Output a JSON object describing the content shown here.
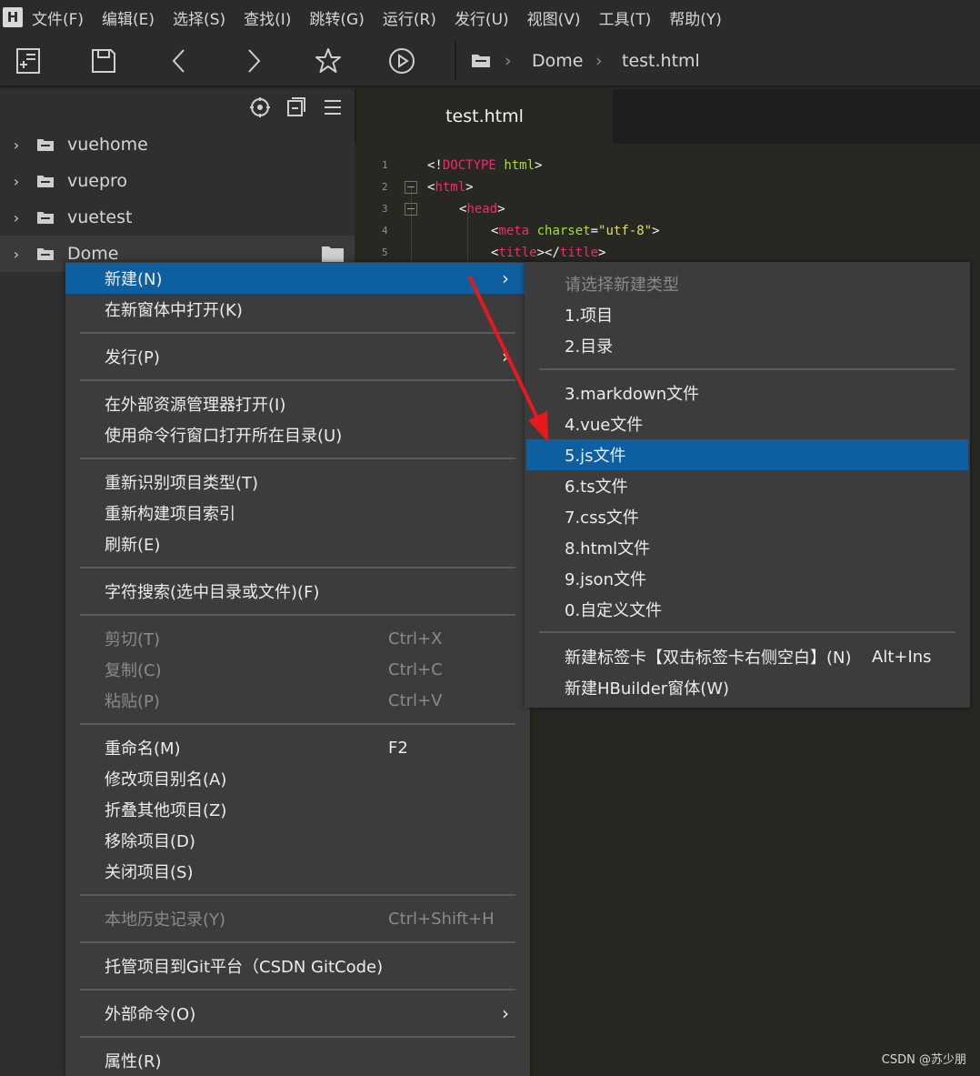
{
  "menubar": {
    "logo": "H",
    "items": [
      "文件(F)",
      "编辑(E)",
      "选择(S)",
      "查找(I)",
      "跳转(G)",
      "运行(R)",
      "发行(U)",
      "视图(V)",
      "工具(T)",
      "帮助(Y)"
    ]
  },
  "toolbar": {
    "breadcrumb": [
      "Dome",
      "test.html"
    ]
  },
  "sidebar": {
    "items": [
      {
        "label": "vuehome"
      },
      {
        "label": "vuepro"
      },
      {
        "label": "vuetest"
      },
      {
        "label": "Dome"
      }
    ]
  },
  "editor": {
    "tab_label": "test.html",
    "line_numbers": [
      "1",
      "2",
      "3",
      "4",
      "5"
    ]
  },
  "context_menu": {
    "new": "新建(N)",
    "open_new_window": "在新窗体中打开(K)",
    "publish": "发行(P)",
    "open_explorer": "在外部资源管理器打开(I)",
    "open_cmd": "使用命令行窗口打开所在目录(U)",
    "reidentify": "重新识别项目类型(T)",
    "rebuild_index": "重新构建项目索引",
    "refresh": "刷新(E)",
    "char_search": "字符搜索(选中目录或文件)(F)",
    "cut": "剪切(T)",
    "cut_shortcut": "Ctrl+X",
    "copy": "复制(C)",
    "copy_shortcut": "Ctrl+C",
    "paste": "粘贴(P)",
    "paste_shortcut": "Ctrl+V",
    "rename": "重命名(M)",
    "rename_shortcut": "F2",
    "alias": "修改项目别名(A)",
    "collapse_others": "折叠其他项目(Z)",
    "remove": "移除项目(D)",
    "close": "关闭项目(S)",
    "history": "本地历史记录(Y)",
    "history_shortcut": "Ctrl+Shift+H",
    "git_host": "托管项目到Git平台（CSDN GitCode)",
    "external_cmd": "外部命令(O)",
    "properties": "属性(R)"
  },
  "submenu": {
    "header": "请选择新建类型",
    "project": "1.项目",
    "directory": "2.目录",
    "markdown": "3.markdown文件",
    "vue": "4.vue文件",
    "js": "5.js文件",
    "ts": "6.ts文件",
    "css": "7.css文件",
    "html": "8.html文件",
    "json": "9.json文件",
    "custom": "0.自定义文件",
    "new_tab": "新建标签卡【双击标签卡右侧空白】(N)",
    "new_tab_shortcut": "Alt+Ins",
    "new_window": "新建HBuilder窗体(W)"
  },
  "watermark": "CSDN @苏少朋",
  "colors": {
    "highlight": "#0e5fa0",
    "arrow": "#e8191c"
  }
}
